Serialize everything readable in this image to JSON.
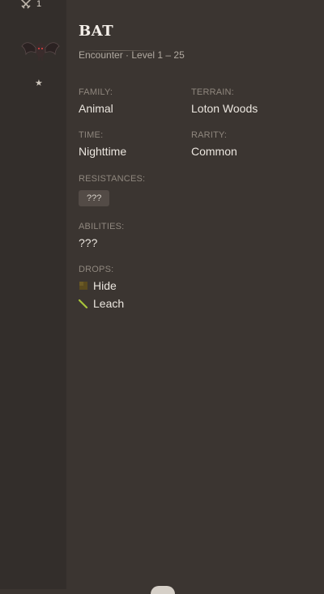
{
  "header": {
    "count": "1"
  },
  "monster": {
    "name": "BAT",
    "subtitle": "Encounter · Level 1 – 25"
  },
  "fields": {
    "family_label": "FAMILY:",
    "family_value": "Animal",
    "terrain_label": "TERRAIN:",
    "terrain_value": "Loton Woods",
    "time_label": "TIME:",
    "time_value": "Nighttime",
    "rarity_label": "RARITY:",
    "rarity_value": "Common",
    "resistances_label": "RESISTANCES:",
    "resistances_value": "???",
    "abilities_label": "ABILITIES:",
    "abilities_value": "???",
    "drops_label": "DROPS:",
    "drops": [
      {
        "name": "Hide",
        "icon": "hide-icon",
        "color": "#5a4a1e"
      },
      {
        "name": "Leach",
        "icon": "leach-icon",
        "color": "#a7c43a"
      }
    ]
  },
  "colors": {
    "background": "#3b3531",
    "sidebar": "#332e2b",
    "text_primary": "#ebe6df",
    "text_label": "#8f877e"
  }
}
